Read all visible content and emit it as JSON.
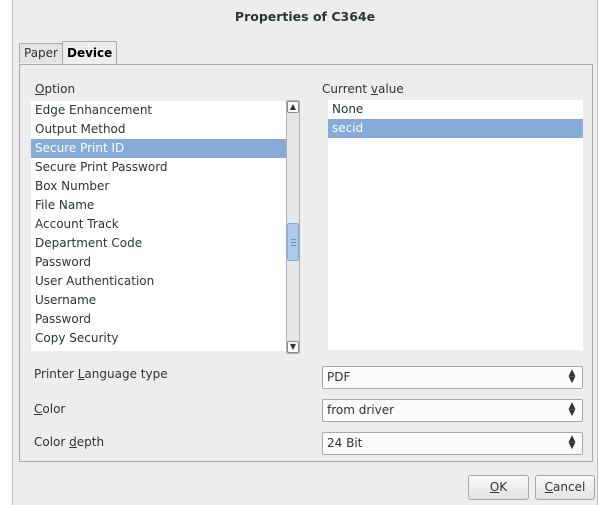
{
  "window": {
    "title": "Properties of C364e"
  },
  "tabs": [
    {
      "label": "Paper",
      "active": false
    },
    {
      "label": "Device",
      "active": true
    }
  ],
  "option_header": {
    "underline": "O",
    "rest": "ption"
  },
  "value_header": {
    "prefix": "Current ",
    "underline": "v",
    "rest": "alue"
  },
  "options": [
    "Edge Enhancement",
    "Output Method",
    "Secure Print ID",
    "Secure Print Password",
    "Box Number",
    "File Name",
    "Account Track",
    "Department Code",
    "Password",
    "User Authentication",
    "Username",
    "Password",
    "Copy Security"
  ],
  "values": [
    "None",
    "secid"
  ],
  "selected_option_index": 2,
  "selected_value_index": 1,
  "printer_language": {
    "prefix": "Printer ",
    "underline": "L",
    "rest": "anguage type",
    "value": "PDF"
  },
  "color": {
    "underline": "C",
    "rest": "olor",
    "value": "from driver"
  },
  "color_depth": {
    "prefix": "Color ",
    "underline": "d",
    "rest": "epth",
    "value": "24 Bit"
  },
  "buttons": {
    "ok": {
      "underline": "O",
      "rest": "K"
    },
    "cancel": {
      "underline": "C",
      "rest": "ancel"
    }
  },
  "colors": {
    "selection": "#86abd9",
    "dialog_bg": "#ededed"
  },
  "icons": {
    "scroll_up": "chevron-up-icon",
    "scroll_down": "chevron-down-icon",
    "combo": "up-down-arrows-icon"
  }
}
